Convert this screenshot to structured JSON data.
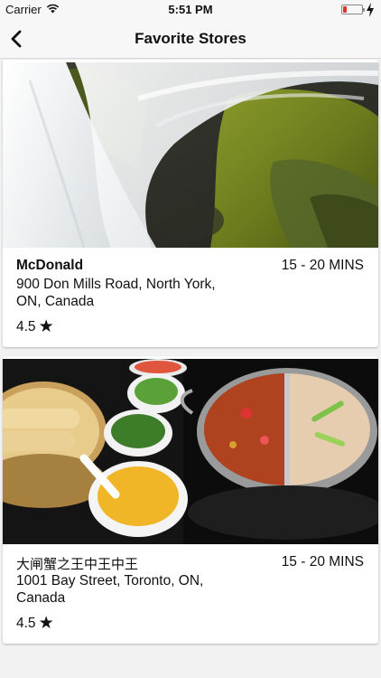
{
  "status_bar": {
    "carrier": "Carrier",
    "time": "5:51 PM",
    "battery_color": "#e0322b"
  },
  "nav": {
    "back_icon": "chevron-left-icon",
    "title": "Favorite Stores"
  },
  "stores": [
    {
      "name": "McDonald",
      "delivery_time": "15 - 20 MINS",
      "address": "900 Don Mills Road, North York, ON, Canada",
      "rating": "4.5",
      "rating_icon": "star-icon"
    },
    {
      "name": "大闸蟹之王中王中王",
      "delivery_time": "15 - 20 MINS",
      "address": "1001 Bay Street, Toronto, ON, Canada",
      "rating": "4.5",
      "rating_icon": "star-icon"
    }
  ]
}
